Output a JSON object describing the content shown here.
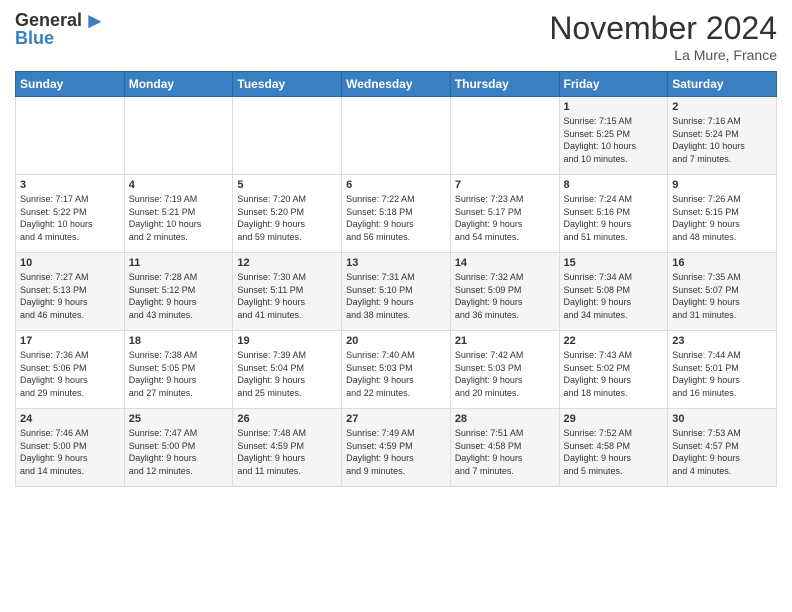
{
  "header": {
    "logo_line1": "General",
    "logo_line2": "Blue",
    "month": "November 2024",
    "location": "La Mure, France"
  },
  "weekdays": [
    "Sunday",
    "Monday",
    "Tuesday",
    "Wednesday",
    "Thursday",
    "Friday",
    "Saturday"
  ],
  "weeks": [
    [
      {
        "day": "",
        "info": ""
      },
      {
        "day": "",
        "info": ""
      },
      {
        "day": "",
        "info": ""
      },
      {
        "day": "",
        "info": ""
      },
      {
        "day": "",
        "info": ""
      },
      {
        "day": "1",
        "info": "Sunrise: 7:15 AM\nSunset: 5:25 PM\nDaylight: 10 hours\nand 10 minutes."
      },
      {
        "day": "2",
        "info": "Sunrise: 7:16 AM\nSunset: 5:24 PM\nDaylight: 10 hours\nand 7 minutes."
      }
    ],
    [
      {
        "day": "3",
        "info": "Sunrise: 7:17 AM\nSunset: 5:22 PM\nDaylight: 10 hours\nand 4 minutes."
      },
      {
        "day": "4",
        "info": "Sunrise: 7:19 AM\nSunset: 5:21 PM\nDaylight: 10 hours\nand 2 minutes."
      },
      {
        "day": "5",
        "info": "Sunrise: 7:20 AM\nSunset: 5:20 PM\nDaylight: 9 hours\nand 59 minutes."
      },
      {
        "day": "6",
        "info": "Sunrise: 7:22 AM\nSunset: 5:18 PM\nDaylight: 9 hours\nand 56 minutes."
      },
      {
        "day": "7",
        "info": "Sunrise: 7:23 AM\nSunset: 5:17 PM\nDaylight: 9 hours\nand 54 minutes."
      },
      {
        "day": "8",
        "info": "Sunrise: 7:24 AM\nSunset: 5:16 PM\nDaylight: 9 hours\nand 51 minutes."
      },
      {
        "day": "9",
        "info": "Sunrise: 7:26 AM\nSunset: 5:15 PM\nDaylight: 9 hours\nand 48 minutes."
      }
    ],
    [
      {
        "day": "10",
        "info": "Sunrise: 7:27 AM\nSunset: 5:13 PM\nDaylight: 9 hours\nand 46 minutes."
      },
      {
        "day": "11",
        "info": "Sunrise: 7:28 AM\nSunset: 5:12 PM\nDaylight: 9 hours\nand 43 minutes."
      },
      {
        "day": "12",
        "info": "Sunrise: 7:30 AM\nSunset: 5:11 PM\nDaylight: 9 hours\nand 41 minutes."
      },
      {
        "day": "13",
        "info": "Sunrise: 7:31 AM\nSunset: 5:10 PM\nDaylight: 9 hours\nand 38 minutes."
      },
      {
        "day": "14",
        "info": "Sunrise: 7:32 AM\nSunset: 5:09 PM\nDaylight: 9 hours\nand 36 minutes."
      },
      {
        "day": "15",
        "info": "Sunrise: 7:34 AM\nSunset: 5:08 PM\nDaylight: 9 hours\nand 34 minutes."
      },
      {
        "day": "16",
        "info": "Sunrise: 7:35 AM\nSunset: 5:07 PM\nDaylight: 9 hours\nand 31 minutes."
      }
    ],
    [
      {
        "day": "17",
        "info": "Sunrise: 7:36 AM\nSunset: 5:06 PM\nDaylight: 9 hours\nand 29 minutes."
      },
      {
        "day": "18",
        "info": "Sunrise: 7:38 AM\nSunset: 5:05 PM\nDaylight: 9 hours\nand 27 minutes."
      },
      {
        "day": "19",
        "info": "Sunrise: 7:39 AM\nSunset: 5:04 PM\nDaylight: 9 hours\nand 25 minutes."
      },
      {
        "day": "20",
        "info": "Sunrise: 7:40 AM\nSunset: 5:03 PM\nDaylight: 9 hours\nand 22 minutes."
      },
      {
        "day": "21",
        "info": "Sunrise: 7:42 AM\nSunset: 5:03 PM\nDaylight: 9 hours\nand 20 minutes."
      },
      {
        "day": "22",
        "info": "Sunrise: 7:43 AM\nSunset: 5:02 PM\nDaylight: 9 hours\nand 18 minutes."
      },
      {
        "day": "23",
        "info": "Sunrise: 7:44 AM\nSunset: 5:01 PM\nDaylight: 9 hours\nand 16 minutes."
      }
    ],
    [
      {
        "day": "24",
        "info": "Sunrise: 7:46 AM\nSunset: 5:00 PM\nDaylight: 9 hours\nand 14 minutes."
      },
      {
        "day": "25",
        "info": "Sunrise: 7:47 AM\nSunset: 5:00 PM\nDaylight: 9 hours\nand 12 minutes."
      },
      {
        "day": "26",
        "info": "Sunrise: 7:48 AM\nSunset: 4:59 PM\nDaylight: 9 hours\nand 11 minutes."
      },
      {
        "day": "27",
        "info": "Sunrise: 7:49 AM\nSunset: 4:59 PM\nDaylight: 9 hours\nand 9 minutes."
      },
      {
        "day": "28",
        "info": "Sunrise: 7:51 AM\nSunset: 4:58 PM\nDaylight: 9 hours\nand 7 minutes."
      },
      {
        "day": "29",
        "info": "Sunrise: 7:52 AM\nSunset: 4:58 PM\nDaylight: 9 hours\nand 5 minutes."
      },
      {
        "day": "30",
        "info": "Sunrise: 7:53 AM\nSunset: 4:57 PM\nDaylight: 9 hours\nand 4 minutes."
      }
    ]
  ]
}
